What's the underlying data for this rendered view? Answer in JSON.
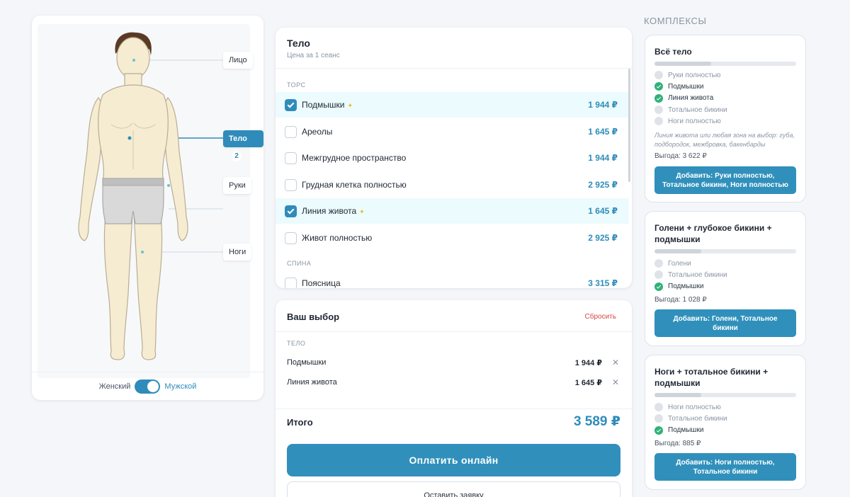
{
  "colors": {
    "accent": "#3090bb",
    "success": "#2fb27a",
    "danger": "#d64545",
    "star": "#f2b51c",
    "highlight": "#ecfbfd"
  },
  "figure": {
    "zones": [
      {
        "label": "Лицо",
        "active": false
      },
      {
        "label": "Тело",
        "active": true,
        "badge": "2"
      },
      {
        "label": "Руки",
        "active": false
      },
      {
        "label": "Ноги",
        "active": false
      }
    ],
    "gender": {
      "female": "Женский",
      "male": "Мужской",
      "selected": "male"
    }
  },
  "services": {
    "title": "Тело",
    "subtitle": "Цена за 1 сеанс",
    "sections": [
      {
        "name": "Торс",
        "items": [
          {
            "name": "Подмышки",
            "price": "1 944 ₽",
            "checked": true,
            "star": true
          },
          {
            "name": "Ареолы",
            "price": "1 645 ₽",
            "checked": false,
            "star": false
          },
          {
            "name": "Межгрудное пространство",
            "price": "1 944 ₽",
            "checked": false,
            "star": false
          },
          {
            "name": "Грудная клетка полностью",
            "price": "2 925 ₽",
            "checked": false,
            "star": false
          },
          {
            "name": "Линия живота",
            "price": "1 645 ₽",
            "checked": true,
            "star": true
          },
          {
            "name": "Живот полностью",
            "price": "2 925 ₽",
            "checked": false,
            "star": false
          }
        ]
      },
      {
        "name": "Спина",
        "items": [
          {
            "name": "Поясница",
            "price": "3 315 ₽",
            "checked": false,
            "star": false
          }
        ]
      }
    ],
    "star_glyph": "✦"
  },
  "selection": {
    "title": "Ваш выбор",
    "reset_label": "Сбросить",
    "section": "Тело",
    "items": [
      {
        "name": "Подмышки",
        "price": "1 944 ₽"
      },
      {
        "name": "Линия живота",
        "price": "1 645 ₽"
      }
    ],
    "remove_glyph": "✕",
    "total_label": "Итого",
    "total_value": "3 589 ₽",
    "pay_label": "Оплатить онлайн",
    "request_label": "Оставить заявку"
  },
  "packages": {
    "heading": "КОМПЛЕКСЫ",
    "items": [
      {
        "title": "Всё тело",
        "progress": 0.4,
        "zones": [
          {
            "name": "Руки полностью",
            "done": false
          },
          {
            "name": "Подмышки",
            "done": true
          },
          {
            "name": "Линия живота",
            "done": true
          },
          {
            "name": "Тотальное бикини",
            "done": false
          },
          {
            "name": "Ноги полностью",
            "done": false
          }
        ],
        "note": "Линия живота или любая зона на выбор: губа, подбородок, межбровка, бакенбарды",
        "savings": "Выгода: 3 622 ₽",
        "button": "Добавить: Руки полностью, Тотальное бикини, Ноги полностью"
      },
      {
        "title": "Голени + глубокое бикини + подмышки",
        "progress": 0.33,
        "zones": [
          {
            "name": "Голени",
            "done": false
          },
          {
            "name": "Тотальное бикини",
            "done": false
          },
          {
            "name": "Подмышки",
            "done": true
          }
        ],
        "note": "",
        "savings": "Выгода: 1 028 ₽",
        "button": "Добавить: Голени, Тотальное бикини"
      },
      {
        "title": "Ноги + тотальное бикини + подмышки",
        "progress": 0.33,
        "zones": [
          {
            "name": "Ноги полностью",
            "done": false
          },
          {
            "name": "Тотальное бикини",
            "done": false
          },
          {
            "name": "Подмышки",
            "done": true
          }
        ],
        "note": "",
        "savings": "Выгода: 885 ₽",
        "button": "Добавить: Ноги полностью, Тотальное бикини"
      }
    ]
  }
}
